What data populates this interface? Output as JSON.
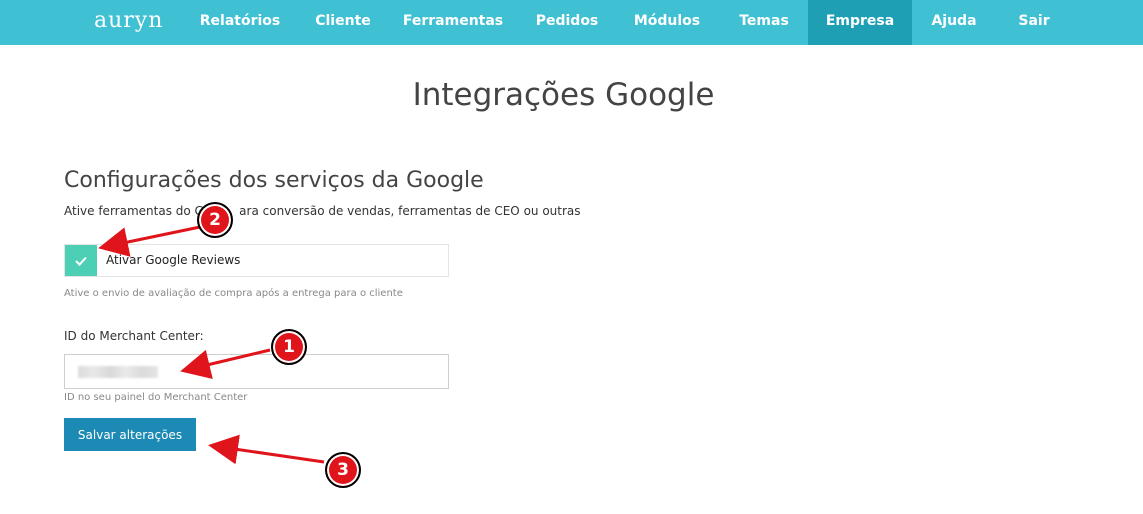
{
  "nav": {
    "logo": "auryn",
    "items": [
      {
        "label": "Relatórios"
      },
      {
        "label": "Cliente"
      },
      {
        "label": "Ferramentas"
      },
      {
        "label": "Pedidos"
      },
      {
        "label": "Módulos"
      },
      {
        "label": "Temas"
      },
      {
        "label": "Empresa",
        "active": true
      },
      {
        "label": "Ajuda"
      },
      {
        "label": "Sair"
      }
    ],
    "accent": "#40c0d3",
    "active_bg": "#1e9fb3"
  },
  "page": {
    "title": "Integrações Google"
  },
  "section": {
    "title": "Configurações dos serviços da Google",
    "description_start": "Ative ferramentas do Go",
    "description_end": "ara conversão de vendas, ferramentas de CEO ou outras"
  },
  "reviews_toggle": {
    "label": "Ativar Google Reviews",
    "checked": true,
    "help": "Ative o envio de avaliação de compra após a entrega para o cliente",
    "icon": "check-icon",
    "color": "#4ccfb4"
  },
  "merchant": {
    "label": "ID do Merchant Center:",
    "help": "ID no seu painel do Merchant Center"
  },
  "save_button": {
    "label": "Salvar alterações",
    "color": "#1c8ab5"
  },
  "annotations": [
    {
      "number": "1"
    },
    {
      "number": "2"
    },
    {
      "number": "3"
    }
  ],
  "annotation_color": "#e0141b"
}
